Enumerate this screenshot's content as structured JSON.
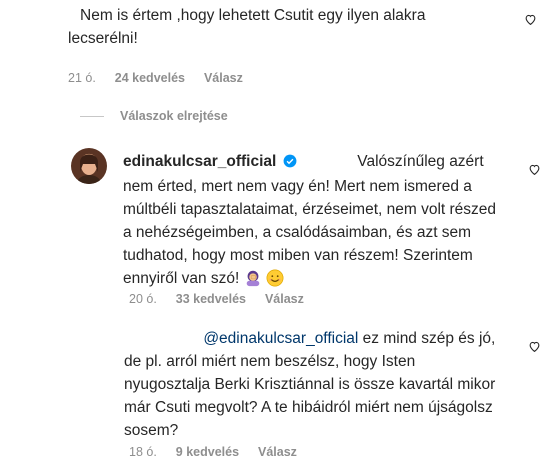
{
  "comment1": {
    "text_line1": "Nem is értem ,hogy lehetett Csutit egy ilyen alakra",
    "text_line2": "lecserélni!",
    "time": "21 ó.",
    "likes": "24 kedvelés",
    "reply": "Válasz"
  },
  "hide_replies": "Válaszok elrejtése",
  "comment2": {
    "username": "edinakulcsar_official",
    "line1": "Valószínűleg azért",
    "line2": "nem érted, mert nem vagy én! Mert nem ismered a",
    "line3": "múltbéli tapasztalataimat, érzéseimet, nem volt részed",
    "line4": "a nehézségeimben, a csalódásaimban, és azt sem",
    "line5": "tudhatod, hogy most miben van részem! Szerintem",
    "line6": "ennyiről van szó!",
    "time": "20 ó.",
    "likes": "33 kedvelés",
    "reply": "Válasz"
  },
  "comment3": {
    "mention": "@edinakulcsar_official",
    "line1": "ez mind szép és jó,",
    "line2": "de pl. arról miért nem beszélsz, hogy Isten",
    "line3": "nyugosztalja Berki Krisztiánnal is össze kavartál mikor",
    "line4": "már Csuti megvolt? A te hibáidról miért nem újságolsz",
    "line5": "sosem?",
    "time": "18 ó.",
    "likes": "9 kedvelés",
    "reply": "Válasz"
  },
  "colors": {
    "verified": "#0095f6",
    "mention": "#00376b",
    "meta": "#8e8e8e"
  }
}
